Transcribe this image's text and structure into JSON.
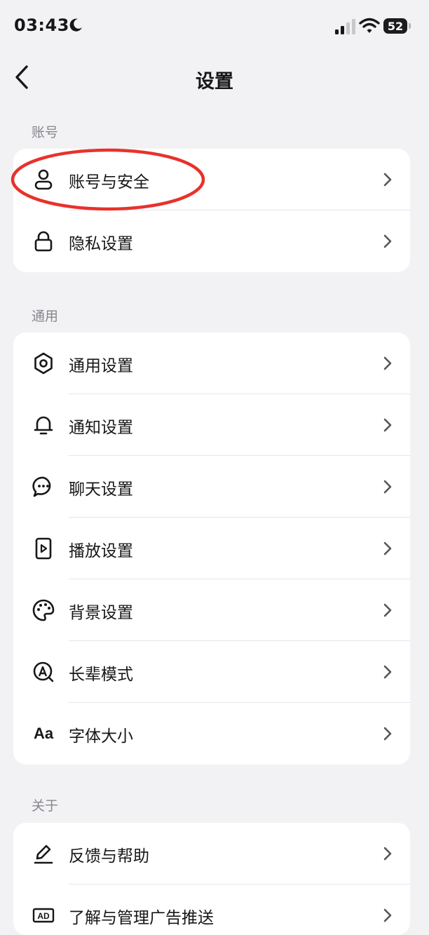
{
  "status_bar": {
    "time": "03:43",
    "battery": "52"
  },
  "header": {
    "title": "设置"
  },
  "sections": [
    {
      "title": "账号",
      "items": [
        {
          "label": "账号与安全",
          "icon": "person-icon"
        },
        {
          "label": "隐私设置",
          "icon": "lock-icon"
        }
      ]
    },
    {
      "title": "通用",
      "items": [
        {
          "label": "通用设置",
          "icon": "gear-icon"
        },
        {
          "label": "通知设置",
          "icon": "bell-icon"
        },
        {
          "label": "聊天设置",
          "icon": "chat-bubble-icon"
        },
        {
          "label": "播放设置",
          "icon": "play-icon"
        },
        {
          "label": "背景设置",
          "icon": "palette-icon"
        },
        {
          "label": "长辈模式",
          "icon": "elder-mode-icon"
        },
        {
          "label": "字体大小",
          "icon": "font-size-icon",
          "icon_text": "Aa"
        }
      ]
    },
    {
      "title": "关于",
      "items": [
        {
          "label": "反馈与帮助",
          "icon": "pencil-icon"
        },
        {
          "label": "了解与管理广告推送",
          "icon": "ad-icon",
          "icon_text": "AD"
        }
      ]
    }
  ],
  "colors": {
    "background": "#f2f2f4",
    "card": "#ffffff",
    "annotation": "#e8322b",
    "secondary_text": "#86868d"
  }
}
